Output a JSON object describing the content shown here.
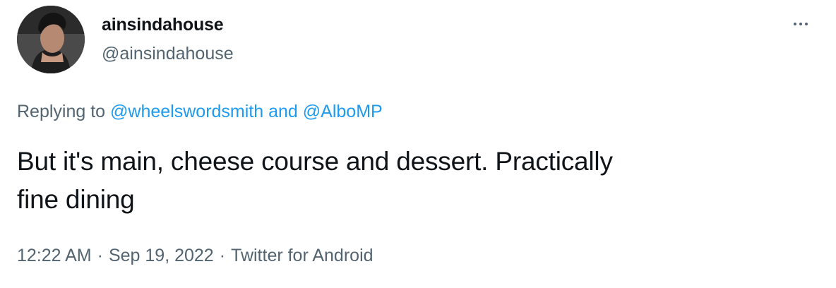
{
  "tweet": {
    "author": {
      "display_name": "ainsindahouse",
      "handle": "@ainsindahouse",
      "avatar_icon": "user-avatar-photo"
    },
    "more_icon": "ellipsis-icon",
    "replying": {
      "prefix": "Replying to",
      "mention_1": "@wheelswordsmith",
      "conjunction": "and",
      "mention_2": "@AlboMP"
    },
    "text_line_1": "But it's main, cheese course and dessert. Practically",
    "text_line_2": "fine dining",
    "meta": {
      "time": "12:22 AM",
      "date": "Sep 19, 2022",
      "source": "Twitter for Android",
      "separator": "·"
    },
    "colors": {
      "text": "#0f1419",
      "secondary": "#536471",
      "link": "#1d9bf0"
    }
  }
}
